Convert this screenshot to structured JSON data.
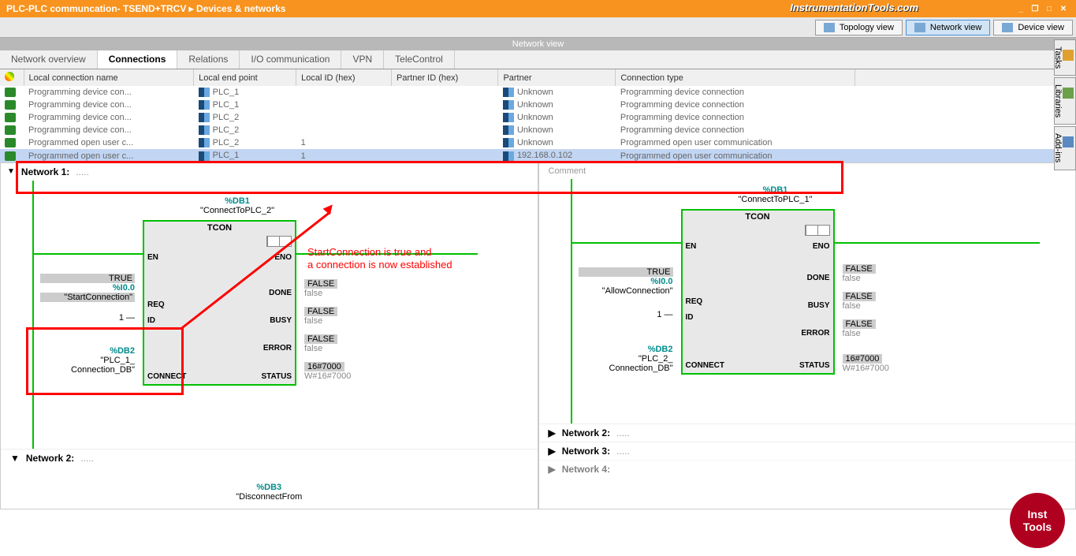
{
  "title": "PLC-PLC communcation- TSEND+TRCV  ▸  Devices & networks",
  "watermark": "InstrumentationTools.com",
  "viewTabs": {
    "topology": "Topology view",
    "network": "Network view",
    "device": "Device view"
  },
  "nvHeader": "Network view",
  "detailTabs": [
    "Network overview",
    "Connections",
    "Relations",
    "I/O communication",
    "VPN",
    "TeleControl"
  ],
  "cols": {
    "c1": "Local connection name",
    "c2": "Local end point",
    "c3": "Local ID (hex)",
    "c4": "Partner ID (hex)",
    "c5": "Partner",
    "c6": "Connection type"
  },
  "rows": [
    {
      "n": "Programming device con...",
      "ep": "PLC_1",
      "lid": "",
      "pid": "",
      "p": "Unknown",
      "ct": "Programming device connection"
    },
    {
      "n": "Programming device con...",
      "ep": "PLC_1",
      "lid": "",
      "pid": "",
      "p": "Unknown",
      "ct": "Programming device connection"
    },
    {
      "n": "Programming device con...",
      "ep": "PLC_2",
      "lid": "",
      "pid": "",
      "p": "Unknown",
      "ct": "Programming device connection"
    },
    {
      "n": "Programming device con...",
      "ep": "PLC_2",
      "lid": "",
      "pid": "",
      "p": "Unknown",
      "ct": "Programming device connection"
    },
    {
      "n": "Programmed open user c...",
      "ep": "PLC_2",
      "lid": "1",
      "pid": "",
      "p": "Unknown",
      "ct": "Programmed open user communication"
    },
    {
      "n": "Programmed open user c...",
      "ep": "PLC_1",
      "lid": "1",
      "pid": "",
      "p": "192.168.0.102",
      "ct": "Programmed open user communication"
    }
  ],
  "annot1": "StartConnection is true and",
  "annot2": "a connection is now established",
  "leftNet": {
    "header": "Network 1:",
    "db": "%DB1",
    "dbname": "\"ConnectToPLC_2\"",
    "block": "TCON",
    "en": "EN",
    "eno": "ENO",
    "req": "REQ",
    "id": "ID",
    "connect": "CONNECT",
    "done": "DONE",
    "busy": "BUSY",
    "error": "ERROR",
    "status": "STATUS",
    "reqVal1": "TRUE",
    "reqVal2": "%I0.0",
    "reqVal3": "\"StartConnection\"",
    "idVal": "1 —",
    "connDb": "%DB2",
    "connName": "\"PLC_1_",
    "connName2": "Connection_DB\"",
    "oFalse": "FALSE",
    "ofalse": "false",
    "statusHex": "16#7000",
    "statusW": "W#16#7000",
    "net2": "Network 2:",
    "db3": "%DB3",
    "disc": "\"DisconnectFrom"
  },
  "rightNet": {
    "comment": "Comment",
    "db": "%DB1",
    "dbname": "\"ConnectToPLC_1\"",
    "block": "TCON",
    "en": "EN",
    "eno": "ENO",
    "req": "REQ",
    "id": "ID",
    "connect": "CONNECT",
    "done": "DONE",
    "busy": "BUSY",
    "error": "ERROR",
    "status": "STATUS",
    "reqVal1": "TRUE",
    "reqVal2": "%I0.0",
    "reqVal3": "\"AllowConnection\"",
    "idVal": "1 —",
    "connDb": "%DB2",
    "connName": "\"PLC_2_",
    "connName2": "Connection_DB\"",
    "oFalse": "FALSE",
    "ofalse": "false",
    "statusHex": "16#7000",
    "statusW": "W#16#7000",
    "net2": "Network 2:",
    "net3": "Network 3:",
    "net4": "Network 4:"
  },
  "side": {
    "tasks": "Tasks",
    "libs": "Libraries",
    "addins": "Add-ins"
  },
  "badge": {
    "l1": "Inst",
    "l2": "Tools"
  }
}
